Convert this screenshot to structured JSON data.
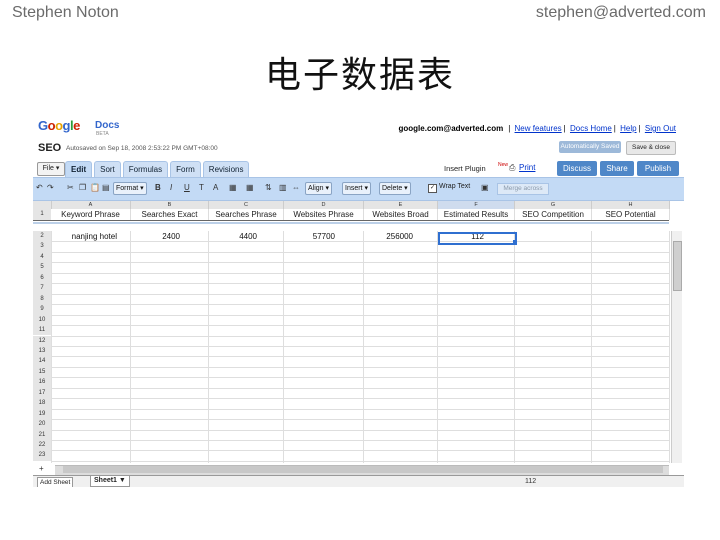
{
  "slide": {
    "author": "Stephen Noton",
    "email": "stephen@adverted.com",
    "title": "电子数据表"
  },
  "app": {
    "logo_letters": [
      "G",
      "o",
      "o",
      "g",
      "l",
      "e"
    ],
    "logo_docs": "Docs",
    "logo_beta": "BETA",
    "account": "google.com@adverted.com",
    "top_links": [
      "New features",
      "Docs Home",
      "Help",
      "Sign Out"
    ],
    "doc_title": "SEO",
    "autosave_text": "Autosaved on Sep 18, 2008 2:53:22 PM GMT+08:00",
    "autosave_btn": "Automatically Saved",
    "save_close_btn": "Save & close"
  },
  "menu": {
    "file": "File ▾",
    "tabs": [
      "Edit",
      "Sort",
      "Formulas",
      "Form",
      "Revisions"
    ],
    "insert_plugin": "Insert Plugin",
    "new_badge": "New",
    "print": "Print",
    "buttons": [
      "Discuss",
      "Share",
      "Publish"
    ]
  },
  "toolbar": {
    "format": "Format ▾",
    "bold": "B",
    "italic": "I",
    "underline": "U",
    "align": "Align ▾",
    "insert": "Insert ▾",
    "delete": "Delete ▾",
    "wrap_text": "Wrap Text",
    "merge": "Merge across"
  },
  "sheet": {
    "columns": [
      "A",
      "B",
      "C",
      "D",
      "E",
      "F",
      "G",
      "H"
    ],
    "headers": [
      "Keyword Phrase",
      "Searches Exact",
      "Searches Phrase",
      "Websites Phrase",
      "Websites Broad",
      "Estimated Results",
      "SEO Competition",
      "SEO Potential"
    ],
    "data_row": [
      "nanjing hotel",
      "2400",
      "4400",
      "57700",
      "256000",
      "112",
      "",
      ""
    ],
    "row_numbers": [
      "1",
      "2",
      "3",
      "4",
      "5",
      "6",
      "7",
      "8",
      "9",
      "10",
      "11",
      "12",
      "13",
      "14",
      "15",
      "16",
      "17",
      "18",
      "19",
      "20",
      "21",
      "22",
      "23"
    ],
    "add_sheet": "Add Sheet",
    "sheet_tab": "Sheet1 ▼",
    "status_value": "112",
    "plus": "+"
  },
  "colors": {
    "tab_bg": "#cfe0f5",
    "toolbar_bg": "#c3daf5",
    "blue_button": "#4f87c8",
    "selection": "#2f6fd0"
  }
}
